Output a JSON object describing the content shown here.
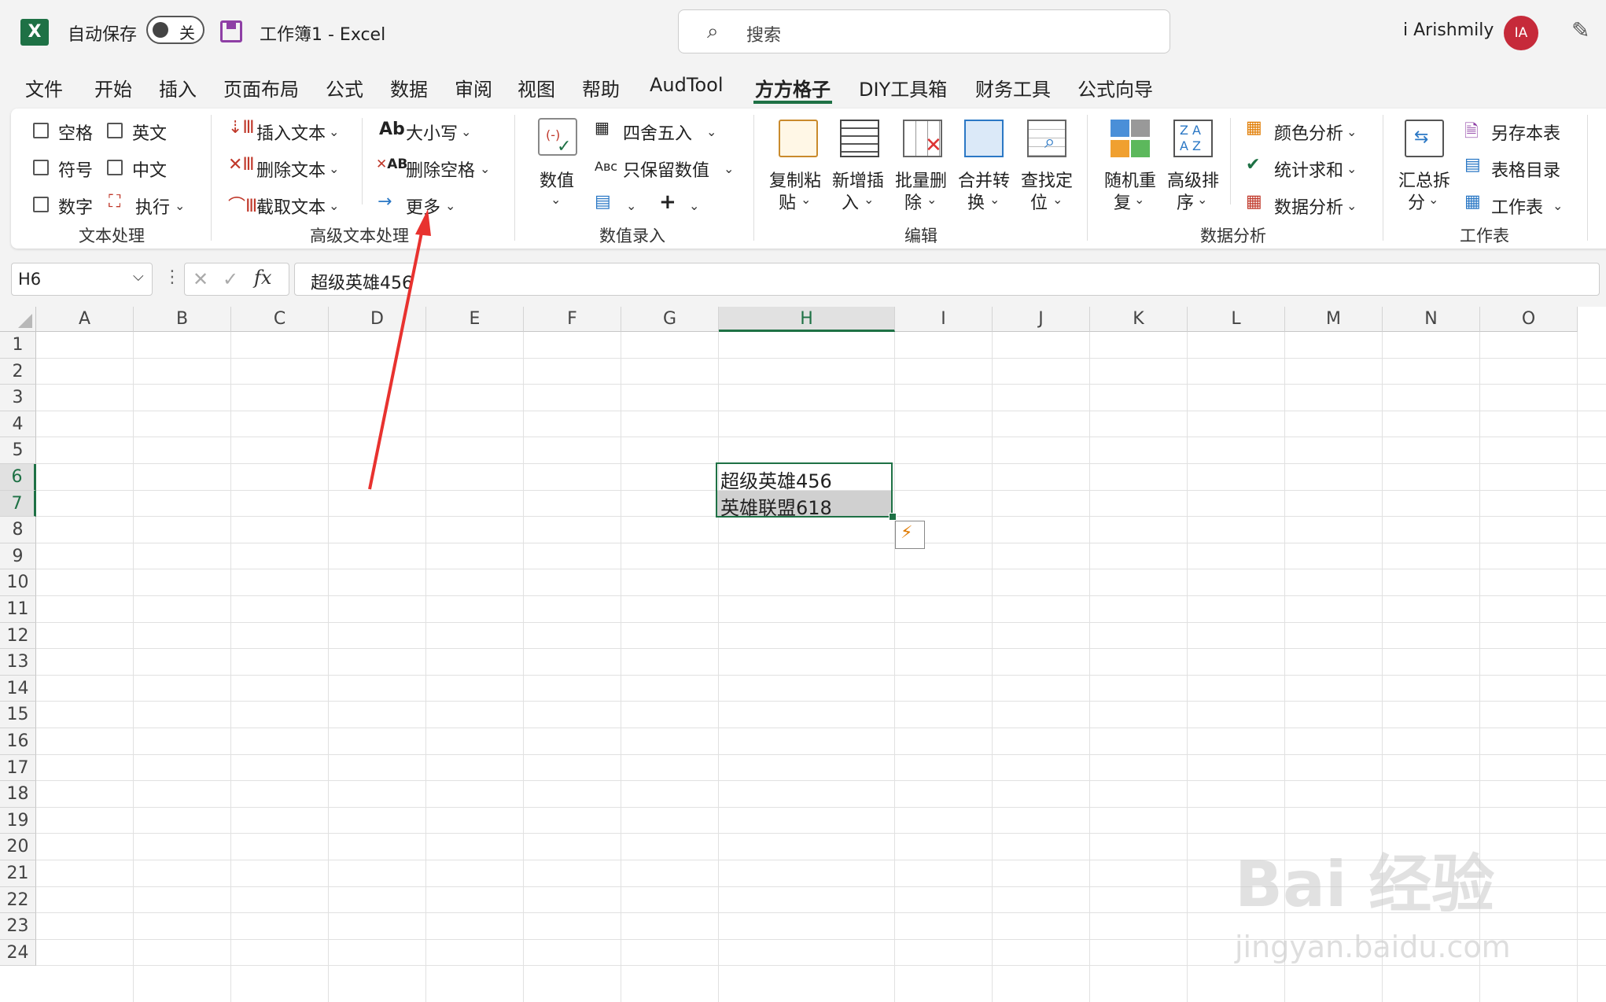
{
  "titlebar": {
    "logo": "X",
    "autosave_label": "自动保存",
    "autosave_state": "关",
    "doc_title": "工作簿1  -  Excel",
    "search_placeholder": "搜索",
    "user_name": "i Arishmily",
    "avatar_initials": "IA"
  },
  "tabs": [
    "文件",
    "开始",
    "插入",
    "页面布局",
    "公式",
    "数据",
    "审阅",
    "视图",
    "帮助",
    "AudTool",
    "方方格子",
    "DIY工具箱",
    "财务工具",
    "公式向导"
  ],
  "active_tab": "方方格子",
  "ribbon": {
    "text_processing": {
      "checkboxes": [
        "空格",
        "英文",
        "符号",
        "中文",
        "数字"
      ],
      "execute": "执行",
      "label": "文本处理"
    },
    "advanced_text": {
      "insert": "插入文本",
      "delete": "删除文本",
      "extract": "截取文本",
      "case": "大小写",
      "delete_space": "删除空格",
      "more": "更多",
      "label": "高级文本处理"
    },
    "data_entry": {
      "value": "数值",
      "round": "四舍五入",
      "keep_value": "只保留数值",
      "label": "数值录入"
    },
    "edit": {
      "items": [
        [
          "复制粘",
          "贴"
        ],
        [
          "新增插",
          "入"
        ],
        [
          "批量删",
          "除"
        ],
        [
          "合并转",
          "换"
        ],
        [
          "查找定",
          "位"
        ]
      ],
      "label": "编辑"
    },
    "analysis": {
      "random": [
        "随机重",
        "复"
      ],
      "sort": [
        "高级排",
        "序"
      ],
      "color": "颜色分析",
      "sum": "统计求和",
      "data": "数据分析",
      "label": "数据分析"
    },
    "worksheet": {
      "summary": [
        "汇总拆",
        "分"
      ],
      "save_as": "另存本表",
      "toc": "表格目录",
      "sheet": "工作表",
      "label": "工作表"
    }
  },
  "formula_bar": {
    "name_box": "H6",
    "fx": "fx",
    "formula": "超级英雄456"
  },
  "columns": [
    "A",
    "B",
    "C",
    "D",
    "E",
    "F",
    "G",
    "H",
    "I",
    "J",
    "K",
    "L",
    "M",
    "N",
    "O"
  ],
  "selected_column": "H",
  "rows": [
    "1",
    "2",
    "3",
    "4",
    "5",
    "6",
    "7",
    "8",
    "9",
    "10",
    "11",
    "12",
    "13",
    "14",
    "15",
    "16",
    "17",
    "18",
    "19",
    "20",
    "21",
    "22",
    "23",
    "24"
  ],
  "selected_rows": [
    "6",
    "7"
  ],
  "cells": {
    "H6": "超级英雄456",
    "H7": "英雄联盟618"
  },
  "watermark": {
    "brand": "Bai 经验",
    "url": "jingyan.baidu.com"
  },
  "colors": {
    "excel_green": "#1e7145",
    "arrow_red": "#e8322f",
    "avatar": "#c62a3a"
  }
}
